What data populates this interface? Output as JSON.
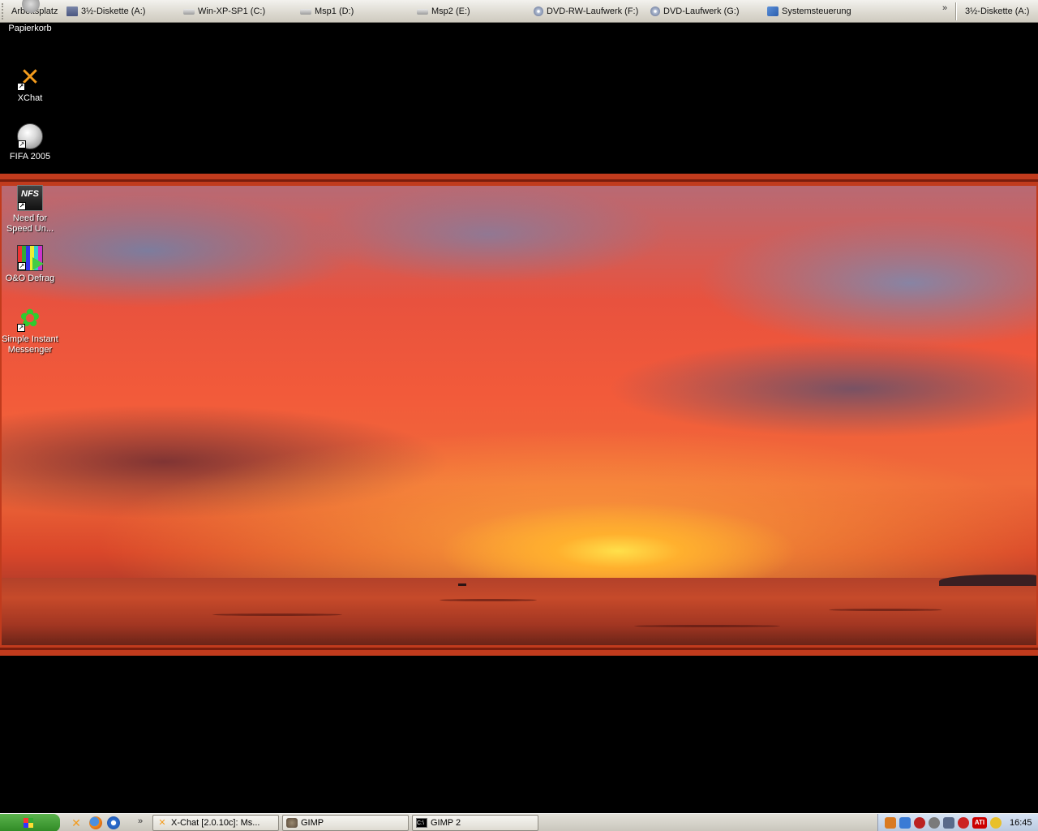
{
  "toolbar": {
    "items": [
      {
        "label": "Arbeitsplatz",
        "icon": "computer-icon"
      },
      {
        "label": "3½-Diskette (A:)",
        "icon": "floppy-icon"
      },
      {
        "label": "Win-XP-SP1 (C:)",
        "icon": "drive-icon"
      },
      {
        "label": "Msp1 (D:)",
        "icon": "drive-icon"
      },
      {
        "label": "Msp2 (E:)",
        "icon": "drive-icon"
      },
      {
        "label": "DVD-RW-Laufwerk (F:)",
        "icon": "dvd-icon"
      },
      {
        "label": "DVD-Laufwerk (G:)",
        "icon": "dvd-icon"
      },
      {
        "label": "Systemsteuerung",
        "icon": "control-panel-icon"
      }
    ],
    "overflow_label": "»",
    "right_item": "3½-Diskette (A:)"
  },
  "desktop_icons": [
    {
      "label": "Papierkorb",
      "icon": "recycle-bin-icon"
    },
    {
      "label": "XChat",
      "icon": "xchat-icon"
    },
    {
      "label": "FIFA 2005",
      "icon": "soccer-ball-icon"
    },
    {
      "label": "Need for Speed Un...",
      "icon": "nfs-icon"
    },
    {
      "label": "O&O Defrag",
      "icon": "defrag-icon"
    },
    {
      "label": "Simple Instant Messenger",
      "icon": "icq-flower-icon"
    }
  ],
  "taskbar": {
    "start_label": "",
    "quick_launch": [
      {
        "icon": "xchat-icon"
      },
      {
        "icon": "firefox-icon"
      },
      {
        "icon": "internet-explorer-icon"
      }
    ],
    "quick_launch_more": "»",
    "tasks": [
      {
        "label": "X-Chat [2.0.10c]: Ms...",
        "icon": "xchat-icon"
      },
      {
        "label": "GIMP",
        "icon": "gimp-icon"
      },
      {
        "label": "GIMP 2",
        "icon": "console-icon"
      }
    ],
    "tray_ati_label": "ATI",
    "clock": "16:45"
  },
  "colors": {
    "wallpaper_frame": "#c13b1d",
    "taskbar": "#d6d3ca",
    "tray": "#c8d6ea",
    "start_button": "#3f9a34"
  }
}
